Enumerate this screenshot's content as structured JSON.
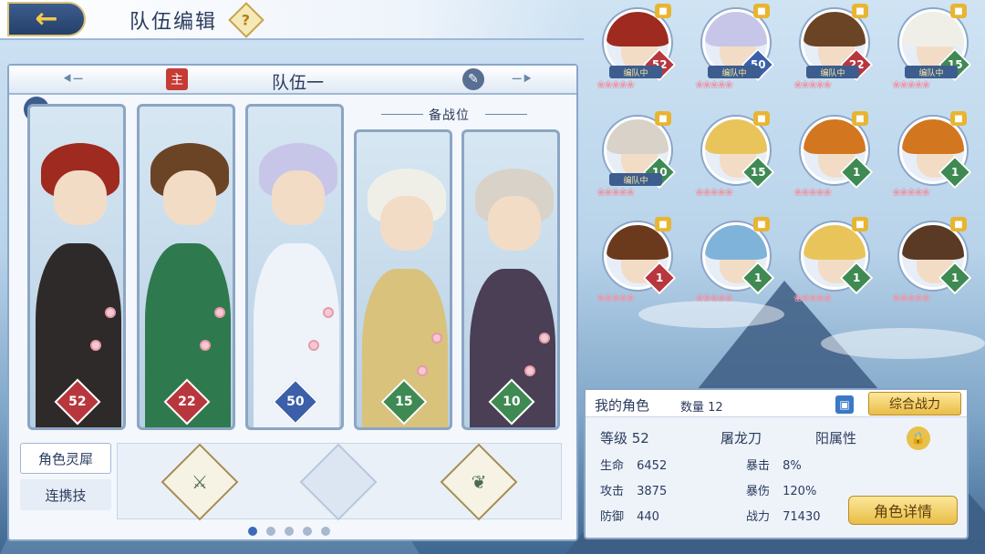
{
  "header": {
    "title": "队伍编辑",
    "help_label": "?"
  },
  "team": {
    "leader_badge": "主",
    "name": "队伍一",
    "reserve_label": "备战位",
    "cards": [
      {
        "level": "52",
        "level_color": "red",
        "hair": "#9e2a20",
        "body": "#2f2a2a"
      },
      {
        "level": "22",
        "level_color": "red",
        "hair": "#6b4426",
        "body": "#2e7a4e"
      },
      {
        "level": "50",
        "level_color": "blue",
        "hair": "#c8c6e8",
        "body": "#eef2f9"
      },
      {
        "level": "15",
        "level_color": "green",
        "hair": "#efefe8",
        "body": "#d9c27c"
      },
      {
        "level": "10",
        "level_color": "green",
        "hair": "#d8d2c8",
        "body": "#4a3f55"
      }
    ]
  },
  "side_tabs": {
    "tab1": "角色灵犀",
    "tab2": "连携技"
  },
  "slots": [
    {
      "glyph": "icon-sword-emblem",
      "filled": true
    },
    {
      "glyph": "",
      "filled": false
    },
    {
      "glyph": "icon-elephant-emblem",
      "filled": true
    }
  ],
  "page_dots": {
    "count": 5,
    "active": 0
  },
  "roster": {
    "in_team_label": "编队中",
    "items": [
      {
        "level": "52",
        "level_color": "red",
        "hair": "#9e2a20",
        "in_team": true
      },
      {
        "level": "50",
        "level_color": "blue",
        "hair": "#c8c6e8",
        "in_team": true
      },
      {
        "level": "22",
        "level_color": "red",
        "hair": "#6b4426",
        "in_team": true
      },
      {
        "level": "15",
        "level_color": "green",
        "hair": "#efefe8",
        "in_team": true
      },
      {
        "level": "10",
        "level_color": "green",
        "hair": "#d8d2c8",
        "in_team": true
      },
      {
        "level": "15",
        "level_color": "green",
        "hair": "#e8c45a",
        "in_team": false
      },
      {
        "level": "1",
        "level_color": "green",
        "hair": "#d2761f",
        "in_team": false
      },
      {
        "level": "1",
        "level_color": "green",
        "hair": "#d2761f",
        "in_team": false
      },
      {
        "level": "1",
        "level_color": "red",
        "hair": "#6b3a1c",
        "in_team": false
      },
      {
        "level": "1",
        "level_color": "green",
        "hair": "#7fb3d9",
        "in_team": false
      },
      {
        "level": "1",
        "level_color": "green",
        "hair": "#e8c45a",
        "in_team": false
      },
      {
        "level": "1",
        "level_color": "green",
        "hair": "#5a3a24",
        "in_team": false
      }
    ]
  },
  "info": {
    "my_roles": "我的角色",
    "count": "数量 12",
    "sort_button": "综合战力",
    "level_label": "等级 52",
    "weapon": "屠龙刀",
    "attribute": "阳属性",
    "stats": {
      "hp_label": "生命",
      "hp": "6452",
      "crit_label": "暴击",
      "crit": "8%",
      "atk_label": "攻击",
      "atk": "3875",
      "critdmg_label": "暴伤",
      "critdmg": "120%",
      "def_label": "防御",
      "def": "440",
      "power_label": "战力",
      "power": "71430"
    },
    "detail_button": "角色详情"
  },
  "colors": {
    "red": "#b8373e",
    "blue": "#3b5fa8",
    "green": "#3f8a53",
    "accent": "#e9bd47"
  }
}
